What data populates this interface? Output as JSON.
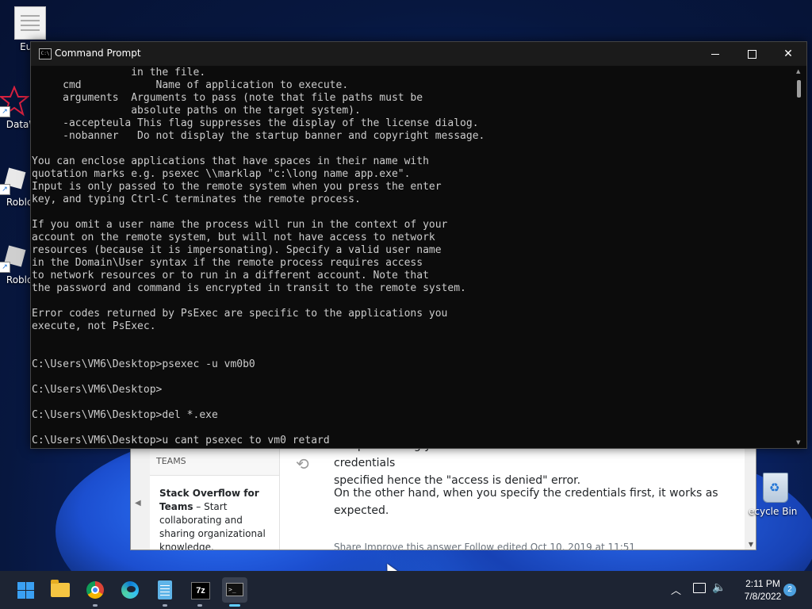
{
  "desktop": {
    "icons": [
      {
        "label": "Eula"
      },
      {
        "label": "DataW"
      },
      {
        "label": "Roblox"
      },
      {
        "label": "Roblox"
      }
    ],
    "recycle_bin": {
      "label": "ecycle Bin"
    }
  },
  "browser": {
    "sidebar_heading": "TEAMS",
    "card_title": "Stack Overflow for Teams",
    "card_body": " – Start collaborating and sharing organizational knowledge.",
    "answer_line1": "computer using your local credentials instead of the domain credentials",
    "answer_line2": "specified hence the \"access is denied\" error.",
    "answer_para2": "On the other hand, when you specify the credentials first, it works as expected.",
    "footer": "Share  Improve this answer  Follow                               edited Oct 10, 2019 at 11:51"
  },
  "cmd": {
    "title": "Command Prompt",
    "icon_text": "C:\\",
    "lines": [
      "                in the file.",
      "     cmd            Name of application to execute.",
      "     arguments  Arguments to pass (note that file paths must be",
      "                absolute paths on the target system).",
      "     -accepteula This flag suppresses the display of the license dialog.",
      "     -nobanner   Do not display the startup banner and copyright message.",
      "",
      "You can enclose applications that have spaces in their name with",
      "quotation marks e.g. psexec \\\\marklap \"c:\\long name app.exe\".",
      "Input is only passed to the remote system when you press the enter",
      "key, and typing Ctrl-C terminates the remote process.",
      "",
      "If you omit a user name the process will run in the context of your",
      "account on the remote system, but will not have access to network",
      "resources (because it is impersonating). Specify a valid user name",
      "in the Domain\\User syntax if the remote process requires access",
      "to network resources or to run in a different account. Note that",
      "the password and command is encrypted in transit to the remote system.",
      "",
      "Error codes returned by PsExec are specific to the applications you",
      "execute, not PsExec.",
      "",
      "",
      "C:\\Users\\VM6\\Desktop>psexec -u vm0b0",
      "",
      "C:\\Users\\VM6\\Desktop>",
      "",
      "C:\\Users\\VM6\\Desktop>del *.exe",
      "",
      "C:\\Users\\VM6\\Desktop>u cant psexec to vm0 retard"
    ]
  },
  "taskbar": {
    "apps": [
      "start-icon",
      "file-explorer-icon",
      "chrome-icon",
      "edge-icon",
      "notepad-icon",
      "7zip-icon",
      "terminal-icon"
    ],
    "sevenzip_label": "7z",
    "terminal_label": ">_",
    "time": "2:11 PM",
    "date": "7/8/2022",
    "notification_count": "2"
  }
}
